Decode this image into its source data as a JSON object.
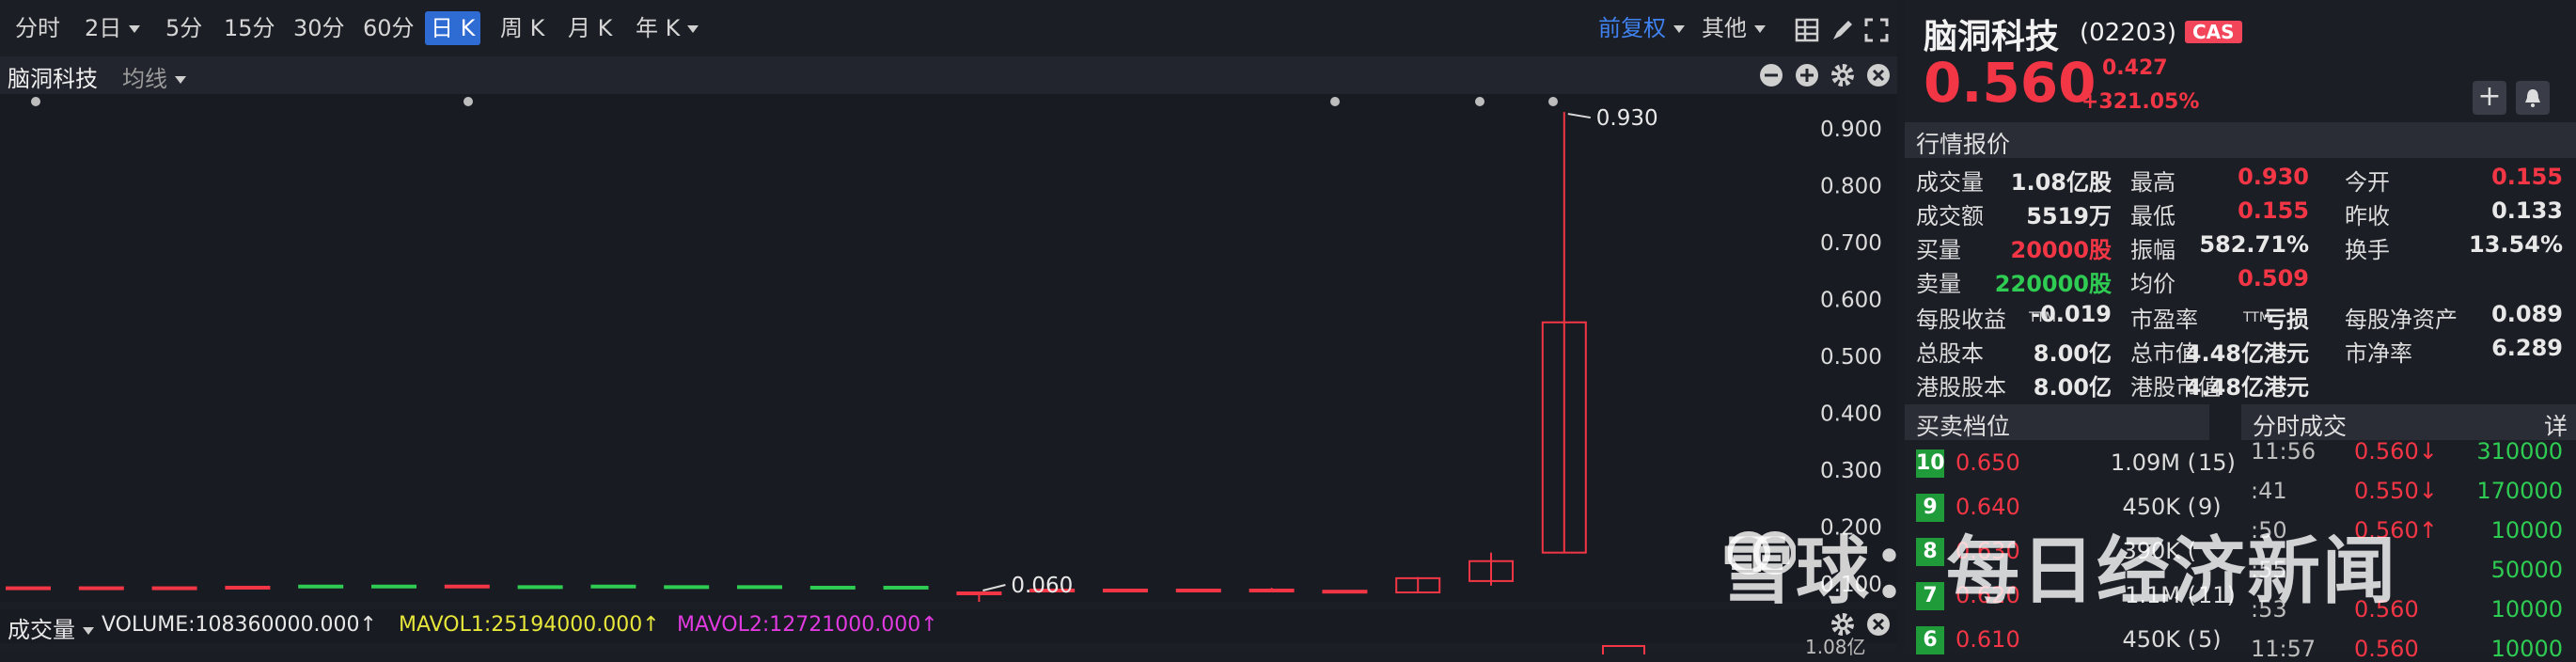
{
  "toolbar": {
    "timeframes": [
      "分时",
      "2日",
      "5分",
      "15分",
      "30分",
      "60分",
      "日 K",
      "周 K",
      "月 K",
      "年 K"
    ],
    "active": "日 K",
    "adjust_label": "前复权",
    "other_label": "其他"
  },
  "subbar": {
    "stock_name": "脑洞科技",
    "indicator": "均线"
  },
  "chart_data": {
    "type": "candlestick",
    "yaxis_ticks": [
      "0.900",
      "0.800",
      "0.700",
      "0.600",
      "0.500",
      "0.400",
      "0.300",
      "0.200",
      "0.100"
    ],
    "ylim": [
      0.085,
      0.945
    ],
    "high_annotation": "0.930",
    "low_annotation": "0.060",
    "candles": [
      {
        "o": 0.094,
        "c": 0.093,
        "h": 0.094,
        "l": 0.092,
        "up": false
      },
      {
        "o": 0.094,
        "c": 0.093,
        "h": 0.094,
        "l": 0.092,
        "up": false
      },
      {
        "o": 0.094,
        "c": 0.093,
        "h": 0.094,
        "l": 0.092,
        "up": false
      },
      {
        "o": 0.095,
        "c": 0.093,
        "h": 0.096,
        "l": 0.092,
        "up": false
      },
      {
        "o": 0.097,
        "c": 0.097,
        "h": 0.097,
        "l": 0.096,
        "up": true
      },
      {
        "o": 0.096,
        "c": 0.097,
        "h": 0.097,
        "l": 0.096,
        "up": true
      },
      {
        "o": 0.097,
        "c": 0.095,
        "h": 0.097,
        "l": 0.093,
        "up": false
      },
      {
        "o": 0.096,
        "c": 0.096,
        "h": 0.096,
        "l": 0.096,
        "up": true
      },
      {
        "o": 0.097,
        "c": 0.096,
        "h": 0.097,
        "l": 0.096,
        "up": true
      },
      {
        "o": 0.096,
        "c": 0.096,
        "h": 0.096,
        "l": 0.095,
        "up": true
      },
      {
        "o": 0.096,
        "c": 0.095,
        "h": 0.096,
        "l": 0.095,
        "up": true
      },
      {
        "o": 0.095,
        "c": 0.095,
        "h": 0.095,
        "l": 0.095,
        "up": true
      },
      {
        "o": 0.095,
        "c": 0.095,
        "h": 0.095,
        "l": 0.095,
        "up": true
      },
      {
        "o": 0.085,
        "c": 0.084,
        "h": 0.086,
        "l": 0.06,
        "up": false
      },
      {
        "o": 0.09,
        "c": 0.087,
        "h": 0.09,
        "l": 0.086,
        "up": false
      },
      {
        "o": 0.09,
        "c": 0.089,
        "h": 0.09,
        "l": 0.088,
        "up": false
      },
      {
        "o": 0.09,
        "c": 0.089,
        "h": 0.09,
        "l": 0.088,
        "up": true
      },
      {
        "o": 0.089,
        "c": 0.09,
        "h": 0.093,
        "l": 0.088,
        "up": true
      },
      {
        "o": 0.088,
        "c": 0.085,
        "h": 0.089,
        "l": 0.085,
        "up": false
      },
      {
        "o": 0.11,
        "c": 0.085,
        "h": 0.112,
        "l": 0.085,
        "up": false
      },
      {
        "o": 0.14,
        "c": 0.105,
        "h": 0.155,
        "l": 0.097,
        "up": false
      },
      {
        "o": 0.56,
        "c": 0.155,
        "h": 0.93,
        "l": 0.155,
        "up": false
      }
    ],
    "markers_count": 5
  },
  "volume_bar": {
    "label": "成交量",
    "volume": "VOLUME:108360000.000↑",
    "mavol1": "MAVOL1:25194000.000↑",
    "mavol2": "MAVOL2:12721000.000↑",
    "axis_label": "1.08亿"
  },
  "quote": {
    "name": "脑洞科技",
    "code": "(02203)",
    "badge": "CAS",
    "price": "0.560",
    "change": "0.427",
    "change_pct": "+321.05%",
    "section_quote": "行情报价",
    "rows": [
      [
        [
          "成交量",
          "1.08亿股",
          ""
        ],
        [
          "最高",
          "0.930",
          "red"
        ],
        [
          "今开",
          "0.155",
          "red"
        ]
      ],
      [
        [
          "成交额",
          "5519万",
          ""
        ],
        [
          "最低",
          "0.155",
          "red"
        ],
        [
          "昨收",
          "0.133",
          ""
        ]
      ],
      [
        [
          "买量",
          "20000股",
          "red"
        ],
        [
          "振幅",
          "582.71%",
          ""
        ],
        [
          "换手",
          "13.54%",
          ""
        ]
      ],
      [
        [
          "卖量",
          "220000股",
          "green"
        ],
        [
          "均价",
          "0.509",
          "red"
        ],
        [
          "",
          "",
          " "
        ]
      ]
    ],
    "rows2": [
      [
        [
          "每股收益",
          "TTM",
          "-0.019"
        ],
        [
          "市盈率",
          "TTM",
          "亏损"
        ],
        [
          "每股净资产",
          "",
          "0.089"
        ]
      ],
      [
        [
          "总股本",
          "",
          "8.00亿"
        ],
        [
          "总市值",
          "",
          "4.48亿港元"
        ],
        [
          "市净率",
          "",
          "6.289"
        ]
      ],
      [
        [
          "港股股本",
          "",
          "8.00亿"
        ],
        [
          "港股市值",
          "",
          "4.48亿港元"
        ],
        [
          "",
          "",
          ""
        ]
      ]
    ],
    "section_orderbook": "买卖档位",
    "section_ticks": "分时成交",
    "ticks_detail": "详",
    "orderbook": [
      {
        "level": "10",
        "price": "0.650",
        "vol": "1.09M (",
        "cnt": "15)"
      },
      {
        "level": "9",
        "price": "0.640",
        "vol": "450K (",
        "cnt": "9)"
      },
      {
        "level": "8",
        "price": "0.630",
        "vol": "390K (",
        "cnt": ""
      },
      {
        "level": "7",
        "price": "0.620",
        "vol": "1.1M (",
        "cnt": "11)"
      },
      {
        "level": "6",
        "price": "0.610",
        "vol": "450K (",
        "cnt": "5)"
      }
    ],
    "ticks": [
      {
        "time": "11:56",
        "price": "0.560↓",
        "vol": "310000",
        "dir": "down"
      },
      {
        "time": ":41",
        "price": "0.550↓",
        "vol": "170000",
        "dir": "down"
      },
      {
        "time": ":50",
        "price": "0.560↑",
        "vol": "10000",
        "dir": "up"
      },
      {
        "time": ":55",
        "price": "",
        "vol": "50000",
        "dir": "up"
      },
      {
        "time": ":53",
        "price": "0.560",
        "vol": "10000",
        "dir": "up"
      },
      {
        "time": "11:57",
        "price": "0.560",
        "vol": "10000",
        "dir": "up"
      }
    ]
  },
  "watermark": "雪球：每日经济新闻",
  "colors": {
    "up": "#f23645",
    "down": "#2ecc52",
    "accent": "#2e6bd3",
    "bg": "#1c1e25"
  }
}
